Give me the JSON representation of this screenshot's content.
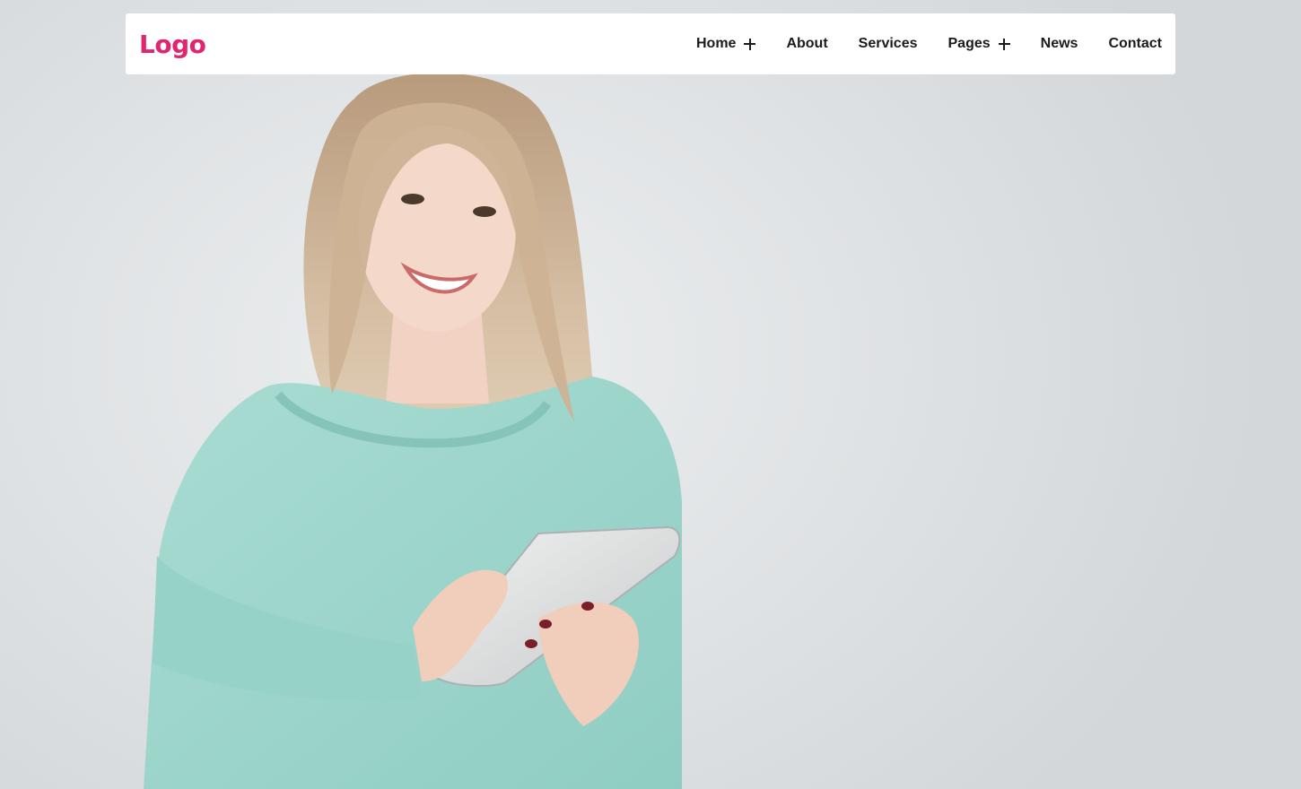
{
  "header": {
    "logo": "Logo",
    "logo_color": "#e0266f",
    "nav": [
      {
        "label": "Home",
        "has_submenu": true,
        "icon": "plus-icon"
      },
      {
        "label": "About",
        "has_submenu": false
      },
      {
        "label": "Services",
        "has_submenu": false
      },
      {
        "label": "Pages",
        "has_submenu": true,
        "icon": "plus-icon"
      },
      {
        "label": "News",
        "has_submenu": false
      },
      {
        "label": "Contact",
        "has_submenu": false
      }
    ]
  },
  "hero": {
    "background_color": "#dde0e2",
    "image": "woman-holding-tablet-photo"
  }
}
